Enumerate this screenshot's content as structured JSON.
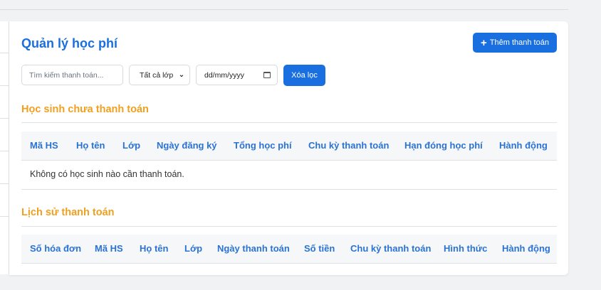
{
  "page": {
    "title": "Quản lý học phí",
    "add_button_label": "Thêm thanh toán"
  },
  "filters": {
    "search_placeholder": "Tìm kiếm thanh toán...",
    "class_select_value": "Tất cả lớp",
    "date_placeholder": "dd/mm/yyyy",
    "clear_button_label": "Xóa lọc"
  },
  "unpaid": {
    "title": "Học sinh chưa thanh toán",
    "columns": [
      "Mã HS",
      "Họ tên",
      "Lớp",
      "Ngày đăng ký",
      "Tổng học phí",
      "Chu kỳ thanh toán",
      "Hạn đóng học phí",
      "Hành động"
    ],
    "empty_message": "Không có học sinh nào cần thanh toán."
  },
  "history": {
    "title": "Lịch sử thanh toán",
    "columns": [
      "Số hóa đơn",
      "Mã HS",
      "Họ tên",
      "Lớp",
      "Ngày thanh toán",
      "Số tiền",
      "Chu kỳ thanh toán",
      "Hình thức",
      "Hành động"
    ]
  },
  "colors": {
    "primary": "#1a6fe0",
    "section_title": "#f0a020",
    "table_header_text": "#2a73d4"
  }
}
